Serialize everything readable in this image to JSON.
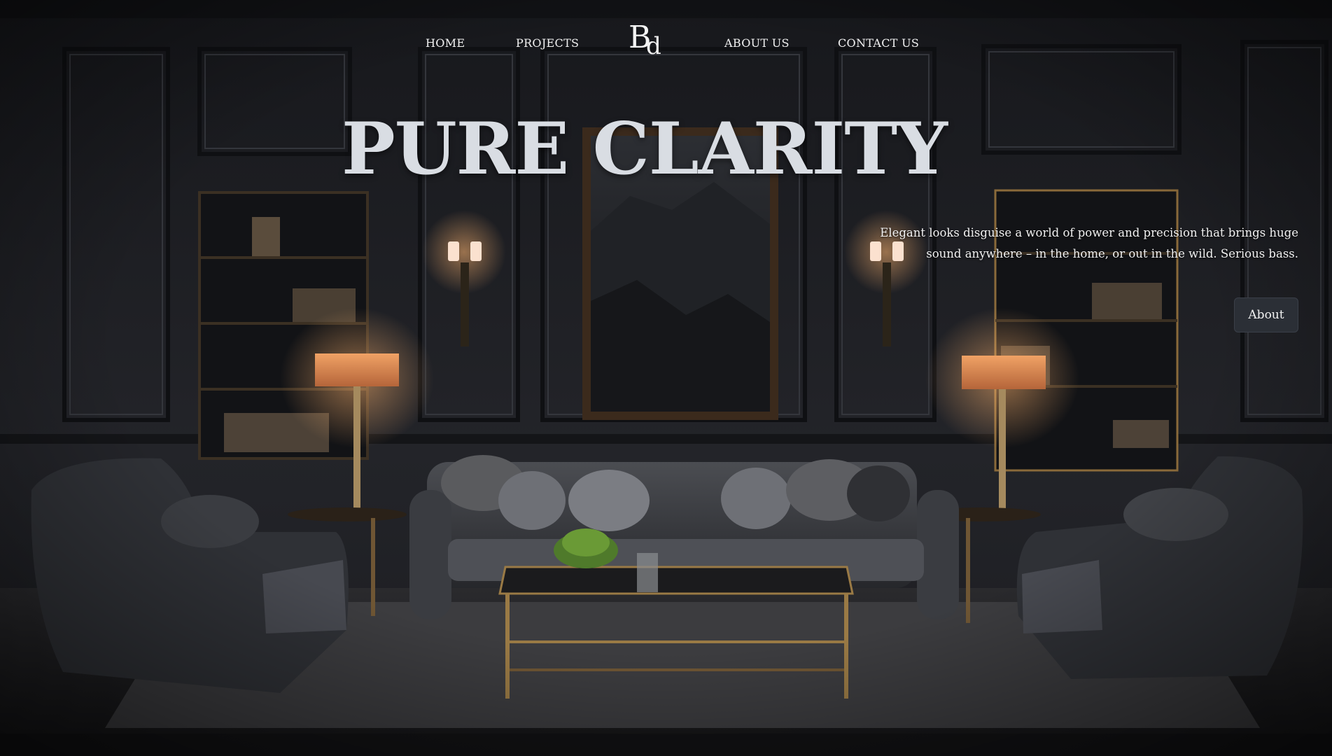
{
  "nav": {
    "home": "HOME",
    "projects": "PROJECTS",
    "about": "ABOUT US",
    "contact": "CONTACT US"
  },
  "logo": {
    "part1": "B",
    "part2": "d"
  },
  "hero": {
    "title": "PURE CLARITY",
    "tagline": "Elegant looks disguise a world of power and precision that brings huge sound anywhere – in the home, or out in the wild. Serious bass.",
    "button_label": "About"
  },
  "colors": {
    "background": "#1a1b1f",
    "title": "#d9dde3",
    "button": "#2b2f36"
  },
  "icons": [
    "logo-monogram"
  ]
}
